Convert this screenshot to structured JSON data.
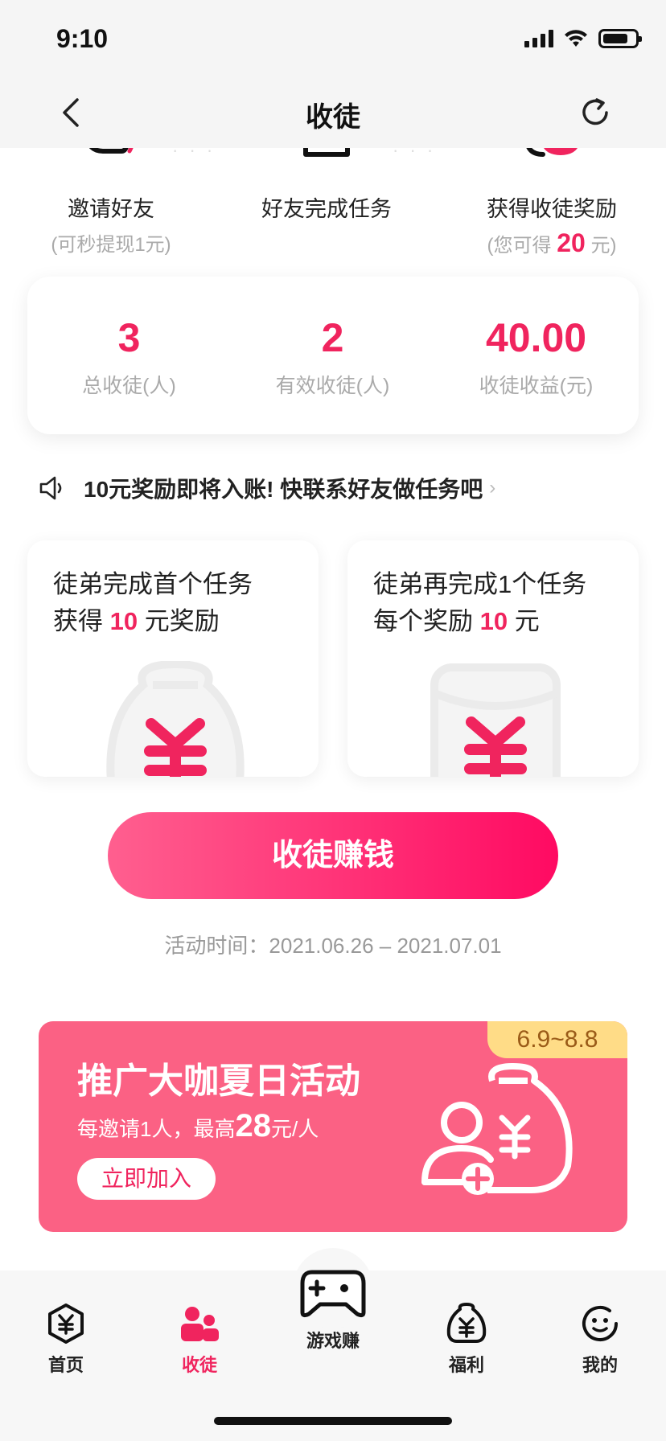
{
  "status_bar": {
    "time": "9:10"
  },
  "nav": {
    "title": "收徒"
  },
  "steps": [
    {
      "title": "邀请好友",
      "sub": "(可秒提现1元)"
    },
    {
      "title": "好友完成任务"
    },
    {
      "title": "获得收徒奖励",
      "sub_prefix": "(您可得 ",
      "sub_value": "20",
      "sub_suffix": " 元)"
    }
  ],
  "stats": [
    {
      "value": "3",
      "label": "总收徒(人)"
    },
    {
      "value": "2",
      "label": "有效收徒(人)"
    },
    {
      "value": "40.00",
      "label": "收徒收益(元)"
    }
  ],
  "notice": {
    "text": "10元奖励即将入账! 快联系好友做任务吧"
  },
  "task_cards": [
    {
      "line1": "徒弟完成首个任务",
      "line2_prefix": "获得 ",
      "line2_value": "10",
      "line2_suffix": " 元奖励"
    },
    {
      "line1": "徒弟再完成1个任务",
      "line2_prefix": "每个奖励 ",
      "line2_value": "10",
      "line2_suffix": " 元"
    }
  ],
  "cta": {
    "label": "收徒赚钱"
  },
  "activity": {
    "time": "活动时间：2021.06.26 – 2021.07.01"
  },
  "banner": {
    "tag": "6.9~8.8",
    "title": "推广大咖夏日活动",
    "sub_prefix": "每邀请1人，最高",
    "sub_value": "28",
    "sub_suffix": "元/人",
    "join_label": "立即加入"
  },
  "tabs": [
    {
      "label": "首页",
      "icon": "home-yuan-icon"
    },
    {
      "label": "收徒",
      "icon": "apprentice-icon",
      "active": true
    },
    {
      "label": "游戏赚",
      "icon": "gamepad-icon"
    },
    {
      "label": "福利",
      "icon": "money-bag-icon"
    },
    {
      "label": "我的",
      "icon": "smiley-icon"
    }
  ],
  "colors": {
    "accent": "#f0245e",
    "banner": "#fb6184",
    "tag": "#ffdc87"
  }
}
